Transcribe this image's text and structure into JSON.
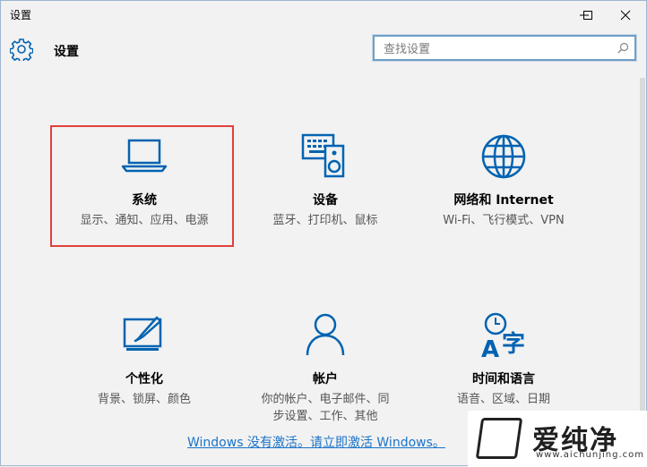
{
  "window": {
    "title": "设置"
  },
  "header": {
    "app_title": "设置"
  },
  "search": {
    "placeholder": "查找设置"
  },
  "tiles": [
    {
      "name": "系统",
      "desc": "显示、通知、应用、电源",
      "icon": "laptop-icon"
    },
    {
      "name": "设备",
      "desc": "蓝牙、打印机、鼠标",
      "icon": "keyboard-speaker-icon"
    },
    {
      "name": "网络和 Internet",
      "desc": "Wi-Fi、飞行模式、VPN",
      "icon": "globe-icon"
    },
    {
      "name": "个性化",
      "desc": "背景、锁屏、颜色",
      "icon": "paint-monitor-icon"
    },
    {
      "name": "帐户",
      "desc": "你的帐户、电子邮件、同步设置、工作、其他",
      "icon": "person-icon"
    },
    {
      "name": "时间和语言",
      "desc": "语音、区域、日期",
      "icon": "time-language-icon"
    }
  ],
  "activation": {
    "text": "Windows 没有激活。请立即激活 Windows。"
  },
  "watermark": {
    "brand": "爱纯净",
    "url": "www.aichunjing.com"
  },
  "colors": {
    "accent": "#0063b1",
    "highlight": "#e0403c",
    "link": "#1a73c8"
  }
}
